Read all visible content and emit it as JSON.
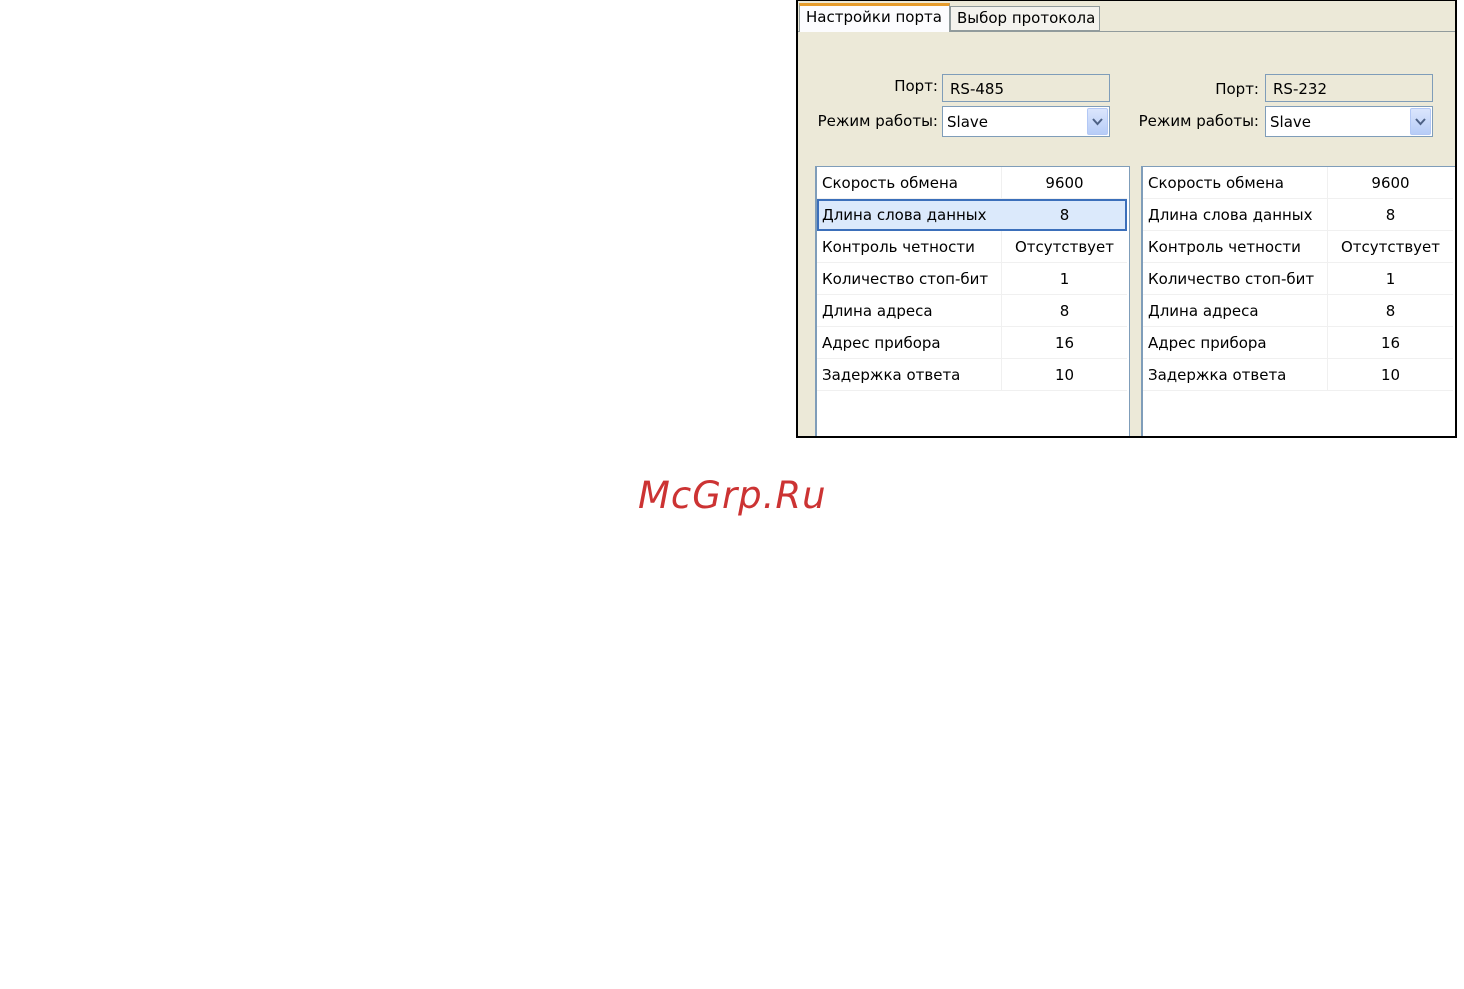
{
  "tabs": [
    {
      "label": "Настройки порта",
      "active": true
    },
    {
      "label": "Выбор протокола",
      "active": false
    }
  ],
  "left_port": {
    "port_label": "Порт:",
    "port_value": "RS-485",
    "mode_label": "Режим работы:",
    "mode_value": "Slave",
    "params": [
      {
        "name": "Скорость обмена",
        "value": "9600"
      },
      {
        "name": "Длина слова данных",
        "value": "8"
      },
      {
        "name": "Контроль четности",
        "value": "Отсутствует"
      },
      {
        "name": "Количество стоп-бит",
        "value": "1"
      },
      {
        "name": "Длина адреса",
        "value": "8"
      },
      {
        "name": "Адрес прибора",
        "value": "16"
      },
      {
        "name": "Задержка ответа",
        "value": "10"
      }
    ]
  },
  "right_port": {
    "port_label": "Порт:",
    "port_value": "RS-232",
    "mode_label": "Режим работы:",
    "mode_value": "Slave",
    "params": [
      {
        "name": "Скорость обмена",
        "value": "9600"
      },
      {
        "name": "Длина слова данных",
        "value": "8"
      },
      {
        "name": "Контроль четности",
        "value": "Отсутствует"
      },
      {
        "name": "Количество стоп-бит",
        "value": "1"
      },
      {
        "name": "Длина адреса",
        "value": "8"
      },
      {
        "name": "Адрес прибора",
        "value": "16"
      },
      {
        "name": "Задержка ответа",
        "value": "10"
      }
    ]
  },
  "watermark": "McGrp.Ru",
  "colors": {
    "watermark": "#cc3333",
    "selection_border": "#3b6fba",
    "active_tab_accent": "#e69c2c",
    "panel_bg": "#ece9d8"
  }
}
